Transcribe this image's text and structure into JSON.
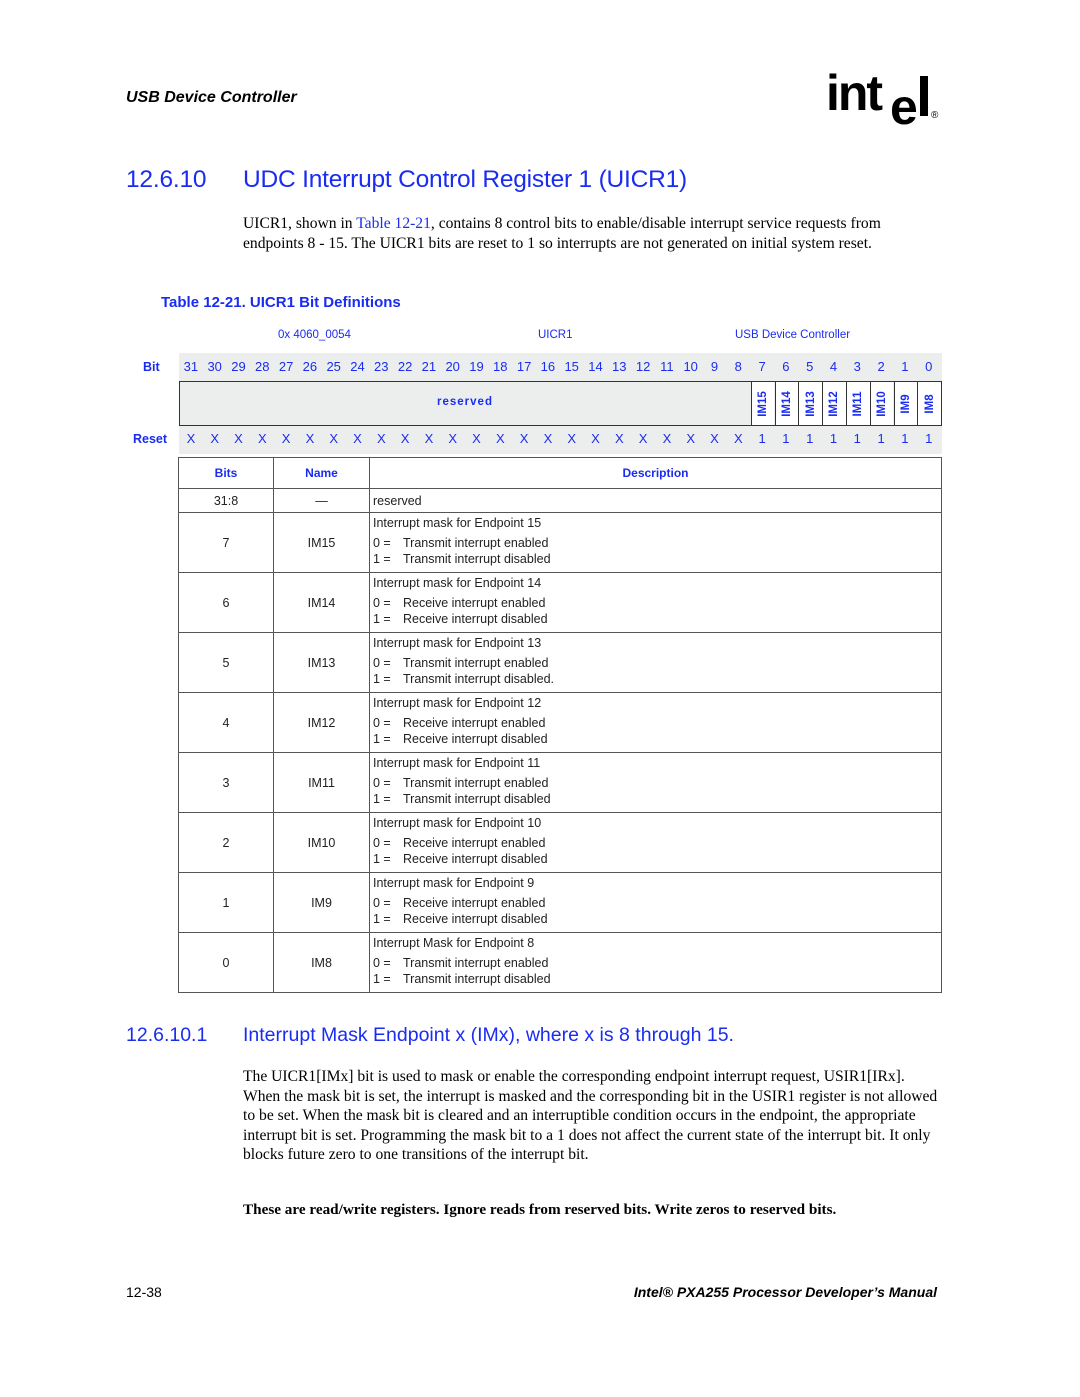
{
  "header": {
    "running_title": "USB Device Controller",
    "logo_text": "intel",
    "logo_mark": "®"
  },
  "section": {
    "number": "12.6.10",
    "title": "UDC Interrupt Control Register 1 (UICR1)",
    "intro_before_link": "UICR1, shown in ",
    "intro_link": "Table 12-21",
    "intro_after_link": ", contains 8 control bits to enable/disable interrupt service requests from endpoints 8 - 15. The UICR1 bits are reset to 1 so interrupts are not generated on initial system reset."
  },
  "table_caption": "Table 12-21. UICR1 Bit Definitions",
  "register": {
    "address": "0x 4060_0054",
    "name": "UICR1",
    "unit": "USB Device Controller",
    "bit_label": "Bit",
    "reset_label": "Reset",
    "reserved_label": "reserved",
    "bits": [
      "31",
      "30",
      "29",
      "28",
      "27",
      "26",
      "25",
      "24",
      "23",
      "22",
      "21",
      "20",
      "19",
      "18",
      "17",
      "16",
      "15",
      "14",
      "13",
      "12",
      "11",
      "10",
      "9",
      "8",
      "7",
      "6",
      "5",
      "4",
      "3",
      "2",
      "1",
      "0"
    ],
    "fields": [
      "IM15",
      "IM14",
      "IM13",
      "IM12",
      "IM11",
      "IM10",
      "IM9",
      "IM8"
    ],
    "reset": [
      "X",
      "X",
      "X",
      "X",
      "X",
      "X",
      "X",
      "X",
      "X",
      "X",
      "X",
      "X",
      "X",
      "X",
      "X",
      "X",
      "X",
      "X",
      "X",
      "X",
      "X",
      "X",
      "X",
      "X",
      "1",
      "1",
      "1",
      "1",
      "1",
      "1",
      "1",
      "1"
    ]
  },
  "bit_table": {
    "headers": {
      "bits": "Bits",
      "name": "Name",
      "description": "Description"
    },
    "reserved_row": {
      "bits": "31:8",
      "name": "—",
      "description": "reserved"
    },
    "rows": [
      {
        "bits": "7",
        "name": "IM15",
        "title": "Interrupt mask for Endpoint 15",
        "v0_key": "0 =",
        "v0": "Transmit interrupt enabled",
        "v1_key": "1 =",
        "v1": "Transmit interrupt disabled"
      },
      {
        "bits": "6",
        "name": "IM14",
        "title": "Interrupt mask for Endpoint 14",
        "v0_key": "0 =",
        "v0": "Receive interrupt enabled",
        "v1_key": "1 =",
        "v1": "Receive interrupt disabled"
      },
      {
        "bits": "5",
        "name": "IM13",
        "title": "Interrupt mask for Endpoint 13",
        "v0_key": "0 =",
        "v0": "Transmit interrupt enabled",
        "v1_key": "1 =",
        "v1": "Transmit interrupt disabled."
      },
      {
        "bits": "4",
        "name": "IM12",
        "title": "Interrupt mask for Endpoint 12",
        "v0_key": "0 =",
        "v0": "Receive interrupt enabled",
        "v1_key": "1 =",
        "v1": "Receive interrupt disabled"
      },
      {
        "bits": "3",
        "name": "IM11",
        "title": "Interrupt mask for Endpoint 11",
        "v0_key": "0 =",
        "v0": "Transmit interrupt enabled",
        "v1_key": "1 =",
        "v1": "Transmit interrupt disabled"
      },
      {
        "bits": "2",
        "name": "IM10",
        "title": "Interrupt mask for Endpoint 10",
        "v0_key": "0 =",
        "v0": "Receive interrupt enabled",
        "v1_key": "1 =",
        "v1": "Receive interrupt disabled"
      },
      {
        "bits": "1",
        "name": "IM9",
        "title": "Interrupt mask for Endpoint 9",
        "v0_key": "0 =",
        "v0": "Receive interrupt enabled",
        "v1_key": "1 =",
        "v1": "Receive interrupt disabled"
      },
      {
        "bits": "0",
        "name": "IM8",
        "title": "Interrupt Mask for Endpoint 8",
        "v0_key": "0 =",
        "v0": "Transmit interrupt enabled",
        "v1_key": "1 =",
        "v1": "Transmit interrupt disabled"
      }
    ]
  },
  "subsection": {
    "number": "12.6.10.1",
    "title": "Interrupt Mask Endpoint x (IMx), where x is 8 through 15.",
    "body": "The UICR1[IMx] bit is used to mask or enable the corresponding endpoint interrupt request, USIR1[IRx]. When the mask bit is set, the interrupt is masked and the corresponding bit in the USIR1 register is not allowed to be set. When the mask bit is cleared and an interruptible condition occurs in the endpoint, the appropriate interrupt bit is set. Programming the mask bit to a 1 does not affect the current state of the interrupt bit. It only blocks future zero to one transitions of the interrupt bit.",
    "note": "These are read/write registers. Ignore reads from reserved bits. Write zeros to reserved bits."
  },
  "footer": {
    "page_number": "12-38",
    "manual_title": "Intel® PXA255 Processor Developer’s Manual"
  },
  "colors": {
    "heading_blue": "#1a2cf0",
    "register_band": "#eceeee"
  }
}
